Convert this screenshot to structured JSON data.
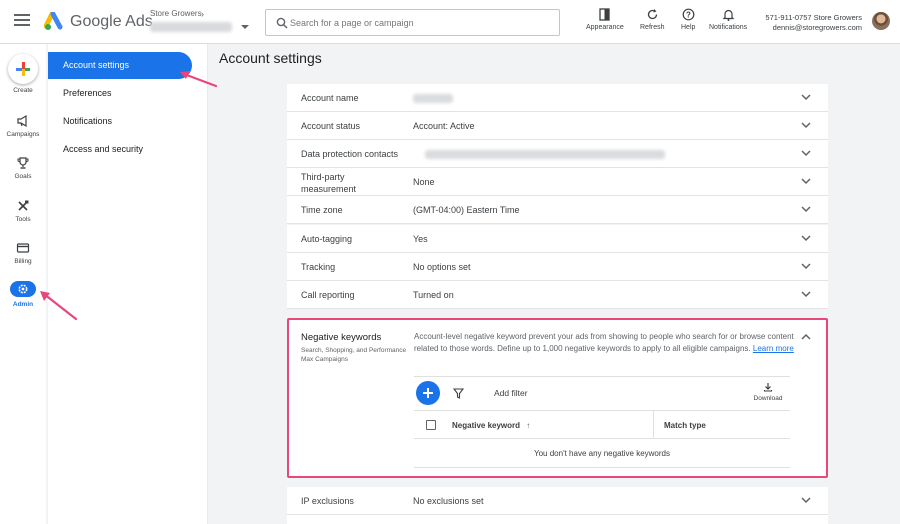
{
  "header": {
    "brand": "Google Ads",
    "account_label": "Store Growers",
    "search_placeholder": "Search for a page or campaign",
    "tools": {
      "appearance": "Appearance",
      "refresh": "Refresh",
      "help": "Help",
      "notifications": "Notifications"
    },
    "user_phone_name": "571-911-0757 Store Growers",
    "user_email": "dennis@storegrowers.com"
  },
  "rail": {
    "create": "Create",
    "campaigns": "Campaigns",
    "goals": "Goals",
    "tools": "Tools",
    "billing": "Billing",
    "admin": "Admin"
  },
  "settings_nav": {
    "items": [
      {
        "label": "Account settings"
      },
      {
        "label": "Preferences"
      },
      {
        "label": "Notifications"
      },
      {
        "label": "Access and security"
      }
    ]
  },
  "page": {
    "title": "Account settings"
  },
  "settings_rows": [
    {
      "label": "Account name",
      "value": ""
    },
    {
      "label": "Account status",
      "value": "Account: Active"
    },
    {
      "label": "Data protection contacts",
      "value": ""
    },
    {
      "label": "Third-party measurement",
      "value": "None"
    },
    {
      "label": "Time zone",
      "value": "(GMT-04:00) Eastern Time"
    },
    {
      "label": "Auto-tagging",
      "value": "Yes"
    },
    {
      "label": "Tracking",
      "value": "No options set"
    },
    {
      "label": "Call reporting",
      "value": "Turned on"
    }
  ],
  "negative_keywords": {
    "title": "Negative keywords",
    "subtitle": "Search, Shopping, and Performance Max Campaigns",
    "description": "Account-level negative keyword prevent your ads from showing to people who search for or browse content related to those words. Define up to 1,000 negative keywords to apply to all eligible campaigns.",
    "learn_more": "Learn more",
    "add_filter": "Add filter",
    "download": "Download",
    "col_keyword": "Negative keyword",
    "col_match": "Match type",
    "empty_text": "You don't have any negative keywords"
  },
  "ip_exclusions": {
    "label": "IP exclusions",
    "value": "No exclusions set"
  },
  "colors": {
    "accent": "#1a73e8",
    "highlight_border": "#e8477a",
    "annotation_arrow": "#e8477a"
  }
}
